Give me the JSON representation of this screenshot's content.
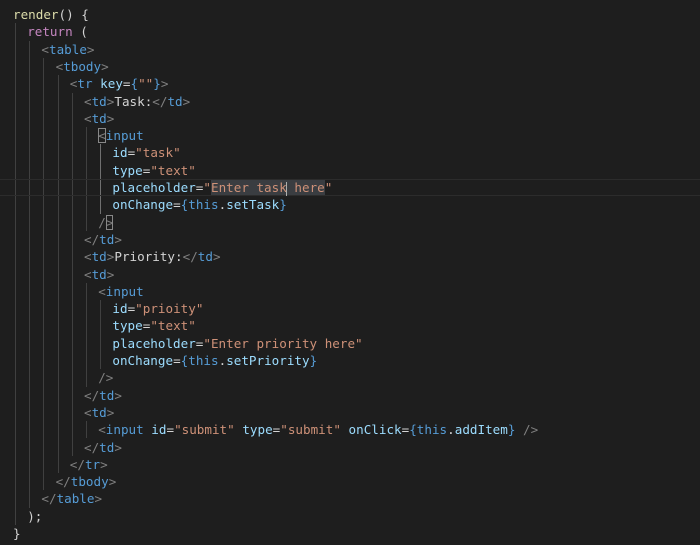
{
  "editor": {
    "theme": "dark",
    "background": "#1e1e1e",
    "lines": [
      {
        "tokens": [
          [
            "render",
            "yellow"
          ],
          [
            "() {",
            "white"
          ]
        ]
      },
      {
        "tokens": [
          [
            "return",
            "purple"
          ],
          [
            " (",
            "white"
          ]
        ]
      },
      {
        "tokens": [
          [
            "<",
            "bracket"
          ],
          [
            "table",
            "tag"
          ],
          [
            ">",
            "bracket"
          ]
        ]
      },
      {
        "tokens": [
          [
            "<",
            "bracket"
          ],
          [
            "tbody",
            "tag"
          ],
          [
            ">",
            "bracket"
          ]
        ]
      },
      {
        "tokens": [
          [
            "<",
            "bracket"
          ],
          [
            "tr",
            "tag"
          ],
          [
            " ",
            "white"
          ],
          [
            "key",
            "attr"
          ],
          [
            "=",
            "white"
          ],
          [
            "{",
            "blue"
          ],
          [
            "\"\"",
            "string"
          ],
          [
            "}",
            "blue"
          ],
          [
            ">",
            "bracket"
          ]
        ]
      },
      {
        "tokens": [
          [
            "<",
            "bracket"
          ],
          [
            "td",
            "tag"
          ],
          [
            ">",
            "bracket"
          ],
          [
            "Task:",
            "white"
          ],
          [
            "</",
            "bracket"
          ],
          [
            "td",
            "tag"
          ],
          [
            ">",
            "bracket"
          ]
        ]
      },
      {
        "tokens": [
          [
            "<",
            "bracket"
          ],
          [
            "td",
            "tag"
          ],
          [
            ">",
            "bracket"
          ]
        ]
      },
      {
        "tokens": [
          [
            "<",
            "bracket"
          ],
          [
            "input",
            "tag"
          ]
        ]
      },
      {
        "tokens": [
          [
            "id",
            "attr"
          ],
          [
            "=",
            "white"
          ],
          [
            "\"task\"",
            "string"
          ]
        ]
      },
      {
        "tokens": [
          [
            "type",
            "attr"
          ],
          [
            "=",
            "white"
          ],
          [
            "\"text\"",
            "string"
          ]
        ]
      },
      {
        "tokens": [
          [
            "placeholder",
            "attr"
          ],
          [
            "=",
            "white"
          ],
          [
            "\"",
            "string"
          ],
          [
            "Enter task",
            "string"
          ],
          [
            "here",
            "string"
          ],
          [
            "\"",
            "string"
          ]
        ]
      },
      {
        "tokens": [
          [
            "onChange",
            "attr"
          ],
          [
            "=",
            "white"
          ],
          [
            "{",
            "blue"
          ],
          [
            "this",
            "blue"
          ],
          [
            ".",
            "white"
          ],
          [
            "setTask",
            "attr"
          ],
          [
            "}",
            "blue"
          ]
        ]
      },
      {
        "tokens": [
          [
            "/",
            "bracket"
          ],
          [
            ">",
            "bracket"
          ]
        ]
      },
      {
        "tokens": [
          [
            "</",
            "bracket"
          ],
          [
            "td",
            "tag"
          ],
          [
            ">",
            "bracket"
          ]
        ]
      },
      {
        "tokens": [
          [
            "<",
            "bracket"
          ],
          [
            "td",
            "tag"
          ],
          [
            ">",
            "bracket"
          ],
          [
            "Priority:",
            "white"
          ],
          [
            "</",
            "bracket"
          ],
          [
            "td",
            "tag"
          ],
          [
            ">",
            "bracket"
          ]
        ]
      },
      {
        "tokens": [
          [
            "<",
            "bracket"
          ],
          [
            "td",
            "tag"
          ],
          [
            ">",
            "bracket"
          ]
        ]
      },
      {
        "tokens": [
          [
            "<",
            "bracket"
          ],
          [
            "input",
            "tag"
          ]
        ]
      },
      {
        "tokens": [
          [
            "id",
            "attr"
          ],
          [
            "=",
            "white"
          ],
          [
            "\"prioity\"",
            "string"
          ]
        ]
      },
      {
        "tokens": [
          [
            "type",
            "attr"
          ],
          [
            "=",
            "white"
          ],
          [
            "\"text\"",
            "string"
          ]
        ]
      },
      {
        "tokens": [
          [
            "placeholder",
            "attr"
          ],
          [
            "=",
            "white"
          ],
          [
            "\"Enter priority here\"",
            "string"
          ]
        ]
      },
      {
        "tokens": [
          [
            "onChange",
            "attr"
          ],
          [
            "=",
            "white"
          ],
          [
            "{",
            "blue"
          ],
          [
            "this",
            "blue"
          ],
          [
            ".",
            "white"
          ],
          [
            "setPriority",
            "attr"
          ],
          [
            "}",
            "blue"
          ]
        ]
      },
      {
        "tokens": [
          [
            "/>",
            "bracket"
          ]
        ]
      },
      {
        "tokens": [
          [
            "</",
            "bracket"
          ],
          [
            "td",
            "tag"
          ],
          [
            ">",
            "bracket"
          ]
        ]
      },
      {
        "tokens": [
          [
            "<",
            "bracket"
          ],
          [
            "td",
            "tag"
          ],
          [
            ">",
            "bracket"
          ]
        ]
      },
      {
        "tokens": [
          [
            "<",
            "bracket"
          ],
          [
            "input",
            "tag"
          ],
          [
            " ",
            "white"
          ],
          [
            "id",
            "attr"
          ],
          [
            "=",
            "white"
          ],
          [
            "\"submit\"",
            "string"
          ],
          [
            " ",
            "white"
          ],
          [
            "type",
            "attr"
          ],
          [
            "=",
            "white"
          ],
          [
            "\"submit\"",
            "string"
          ],
          [
            " ",
            "white"
          ],
          [
            "onClick",
            "attr"
          ],
          [
            "=",
            "white"
          ],
          [
            "{",
            "blue"
          ],
          [
            "this",
            "blue"
          ],
          [
            ".",
            "white"
          ],
          [
            "addItem",
            "attr"
          ],
          [
            "}",
            "blue"
          ],
          [
            " ",
            "white"
          ],
          [
            "/>",
            "bracket"
          ]
        ]
      },
      {
        "tokens": [
          [
            "</",
            "bracket"
          ],
          [
            "td",
            "tag"
          ],
          [
            ">",
            "bracket"
          ]
        ]
      },
      {
        "tokens": [
          [
            "</",
            "bracket"
          ],
          [
            "tr",
            "tag"
          ],
          [
            ">",
            "bracket"
          ]
        ]
      },
      {
        "tokens": [
          [
            "</",
            "bracket"
          ],
          [
            "tbody",
            "tag"
          ],
          [
            ">",
            "bracket"
          ]
        ]
      },
      {
        "tokens": [
          [
            "</",
            "bracket"
          ],
          [
            "table",
            "tag"
          ],
          [
            ">",
            "bracket"
          ]
        ]
      },
      {
        "tokens": [
          [
            ");",
            "white"
          ]
        ]
      },
      {
        "tokens": [
          [
            "}",
            "white"
          ]
        ]
      }
    ]
  }
}
